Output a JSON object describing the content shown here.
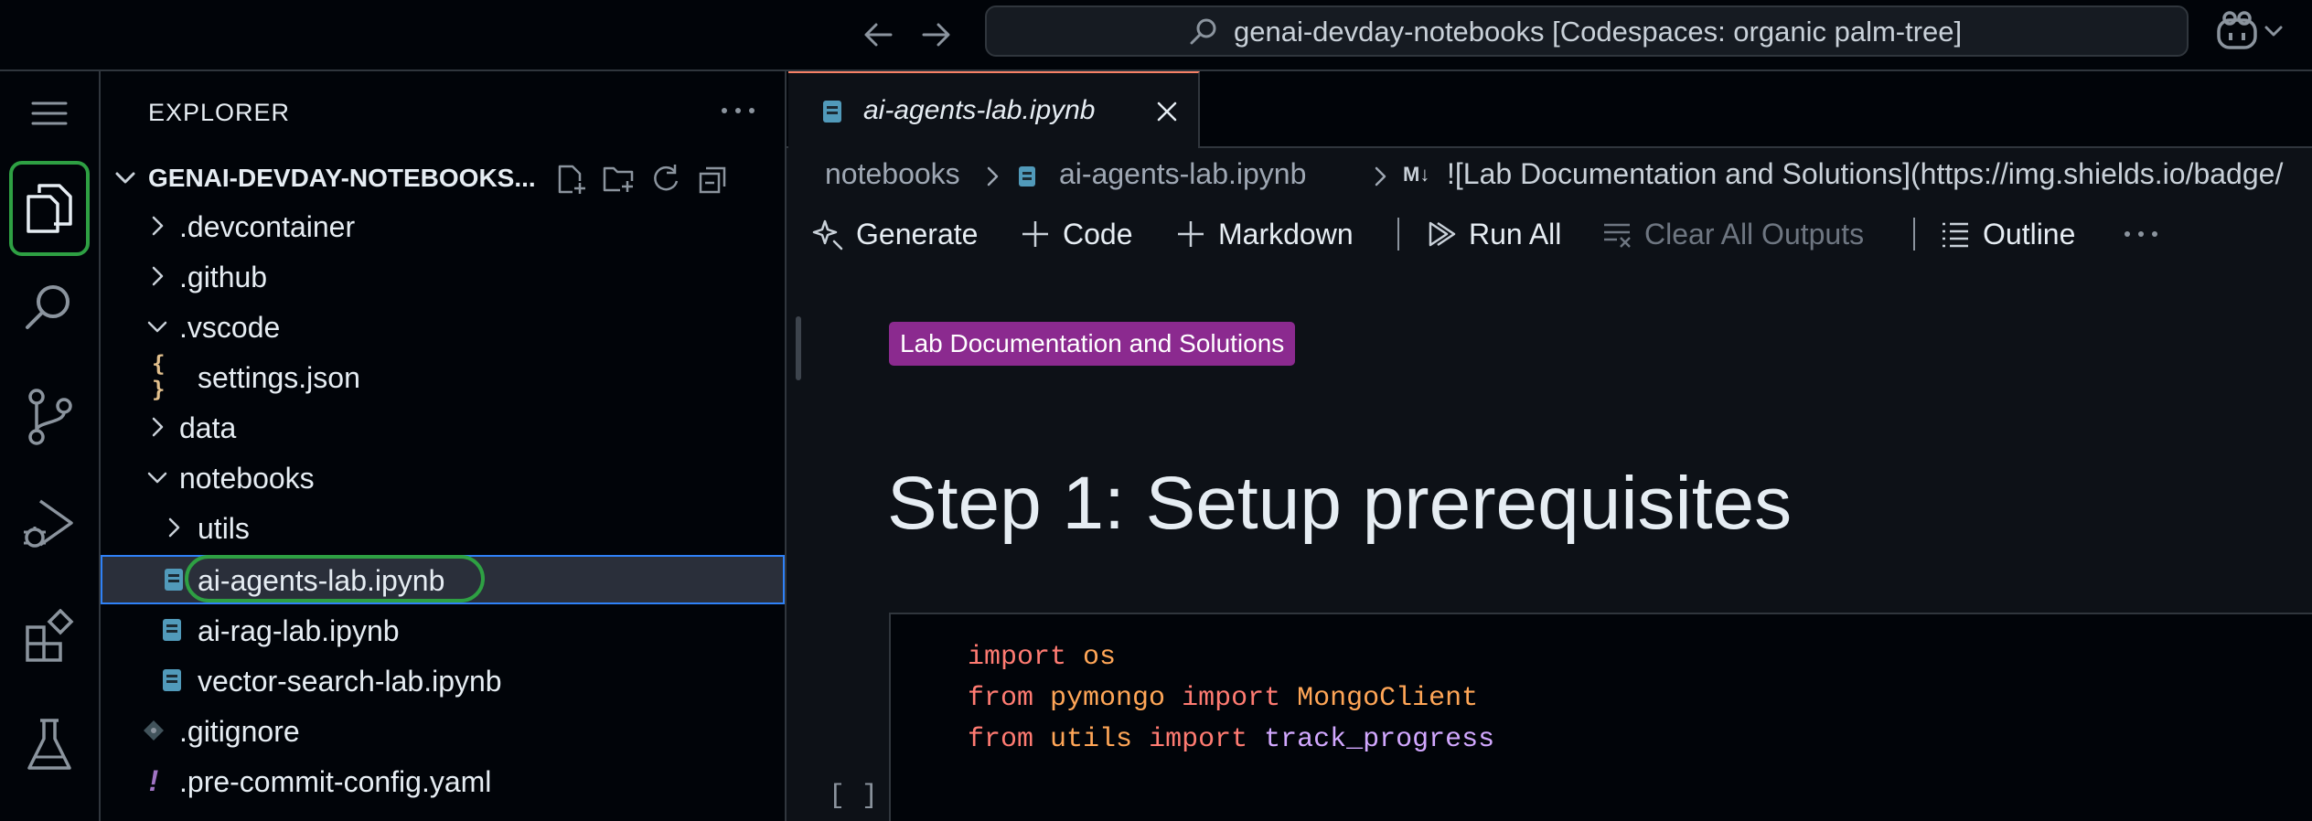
{
  "titlebar": {
    "command_center": "genai-devday-notebooks [Codespaces: organic palm-tree]"
  },
  "explorer": {
    "title": "EXPLORER",
    "root_label": "GENAI-DEVDAY-NOTEBOOKS...",
    "items": [
      {
        "label": ".devcontainer",
        "type": "folder",
        "expanded": false
      },
      {
        "label": ".github",
        "type": "folder",
        "expanded": false
      },
      {
        "label": ".vscode",
        "type": "folder",
        "expanded": true
      },
      {
        "label": "settings.json",
        "type": "json",
        "icon_text": "{ }"
      },
      {
        "label": "data",
        "type": "folder",
        "expanded": false
      },
      {
        "label": "notebooks",
        "type": "folder",
        "expanded": true
      },
      {
        "label": "utils",
        "type": "folder",
        "expanded": false
      },
      {
        "label": "ai-agents-lab.ipynb",
        "type": "notebook",
        "selected": true
      },
      {
        "label": "ai-rag-lab.ipynb",
        "type": "notebook"
      },
      {
        "label": "vector-search-lab.ipynb",
        "type": "notebook"
      },
      {
        "label": ".gitignore",
        "type": "git"
      },
      {
        "label": ".pre-commit-config.yaml",
        "type": "yaml",
        "icon_text": "!"
      }
    ]
  },
  "editor": {
    "tab": {
      "label": "ai-agents-lab.ipynb"
    },
    "breadcrumb": {
      "folder": "notebooks",
      "file": "ai-agents-lab.ipynb",
      "md_icon": "M↓",
      "cell": "![Lab Documentation and Solutions](https://img.shields.io/badge/"
    },
    "toolbar": {
      "generate": "Generate",
      "code": "Code",
      "markdown": "Markdown",
      "run_all": "Run All",
      "clear_outputs": "Clear All Outputs",
      "outline": "Outline"
    },
    "badge": "Lab Documentation and Solutions",
    "heading": "Step 1: Setup prerequisites",
    "code_lines": [
      [
        {
          "t": "import",
          "c": "kw"
        },
        {
          "t": " ",
          "c": "plain"
        },
        {
          "t": "os",
          "c": "mod"
        }
      ],
      [
        {
          "t": "from",
          "c": "kw"
        },
        {
          "t": " ",
          "c": "plain"
        },
        {
          "t": "pymongo",
          "c": "mod"
        },
        {
          "t": " ",
          "c": "plain"
        },
        {
          "t": "import",
          "c": "kw"
        },
        {
          "t": " ",
          "c": "plain"
        },
        {
          "t": "MongoClient",
          "c": "mod"
        }
      ],
      [
        {
          "t": "from",
          "c": "kw"
        },
        {
          "t": " ",
          "c": "plain"
        },
        {
          "t": "utils",
          "c": "mod"
        },
        {
          "t": " ",
          "c": "plain"
        },
        {
          "t": "import",
          "c": "kw"
        },
        {
          "t": " ",
          "c": "plain"
        },
        {
          "t": "track_progress",
          "c": "fn"
        }
      ]
    ],
    "exec_count": "[ ]"
  },
  "colors": {
    "accent_green": "#2ea043",
    "selection_blue": "#2f81f7",
    "badge_purple": "#8b2a8f",
    "tab_top": "#f78166"
  }
}
